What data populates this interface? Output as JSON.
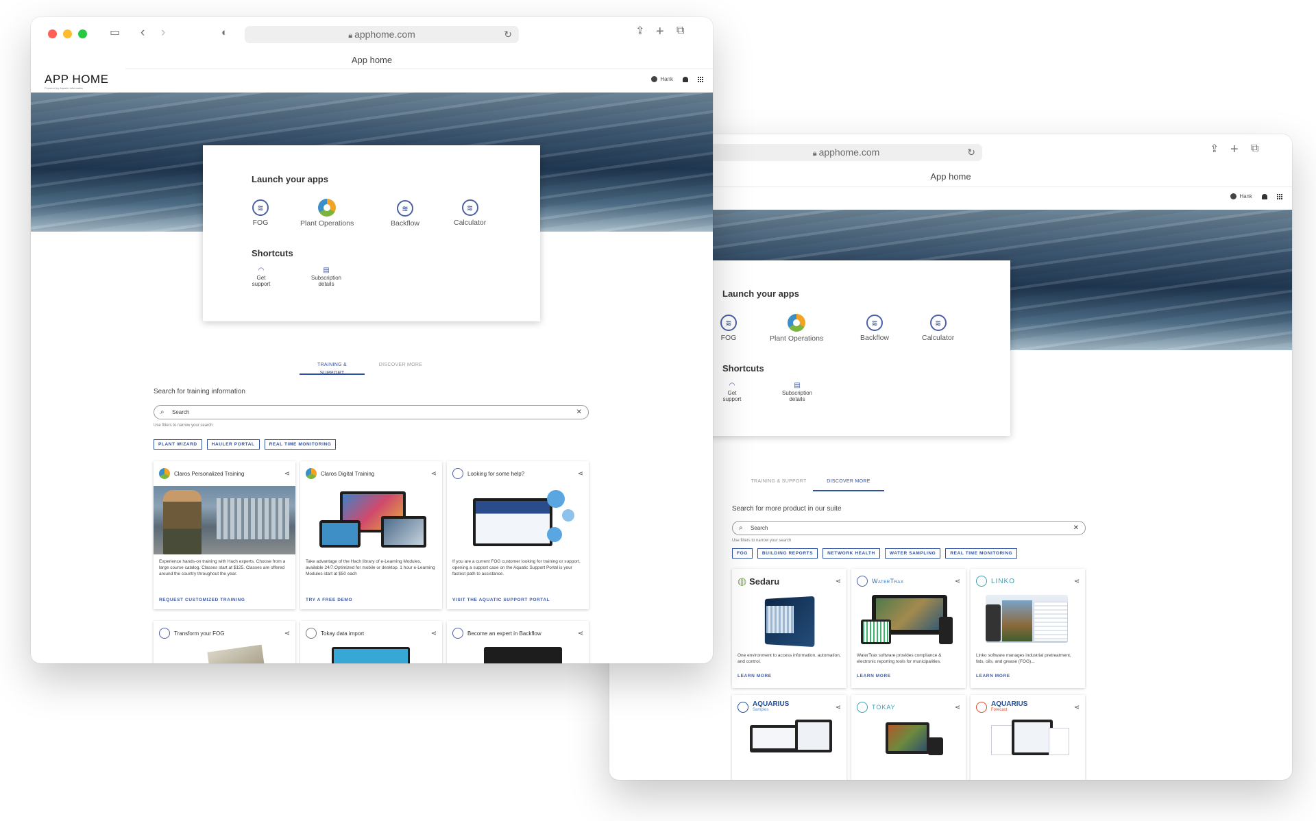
{
  "browser": {
    "url": "apphome.com",
    "title": "App home"
  },
  "header": {
    "brand": "APP HOME",
    "brand_sub": "Powered by Aquatic Informatics",
    "user": "Hank"
  },
  "launch": {
    "title": "Launch your apps",
    "apps": [
      {
        "label": "FOG",
        "icon": "waves-icon"
      },
      {
        "label": "Plant Operations",
        "icon": "claros-icon"
      },
      {
        "label": "Backflow",
        "icon": "waves-icon"
      },
      {
        "label": "Calculator",
        "icon": "waves-icon"
      }
    ],
    "shortcuts_title": "Shortcuts",
    "shortcuts": [
      {
        "line1": "Get",
        "line2": "support",
        "icon": "headset-icon"
      },
      {
        "line1": "Subscription",
        "line2": "details",
        "icon": "document-icon"
      }
    ]
  },
  "tabs": [
    "TRAINING & SUPPORT",
    "DISCOVER MORE"
  ],
  "training": {
    "search_label": "Search for training information",
    "search_placeholder": "Search",
    "hint": "Use filters to narrow your search",
    "chips": [
      "PLANT WIZARD",
      "HAULER PORTAL",
      "REAL TIME MONITORING"
    ],
    "cards": [
      {
        "title": "Claros Personalized Training",
        "desc": "Experience hands-on training with Hach experts. Choose from a large course catalog. Classes start at $125. Classes are offered around the country throughout the year.",
        "cta": "REQUEST CUSTOMIZED TRAINING"
      },
      {
        "title": "Claros Digital Training",
        "desc": "Take advantage of the Hach library of e-Learning Modules, available 24/7.Optimized for mobile or desktop. 1 hour e-Learning Modules start at $50 each",
        "cta": "TRY A FREE DEMO"
      },
      {
        "title": "Looking for some help?",
        "desc": "If you are a current FOG customer looking for training or support, opening a support case on the Aquatic Support Portal is your fastest path to assistance.",
        "cta": "VISIT THE AQUATIC SUPPORT PORTAL"
      },
      {
        "title": "Transform your FOG"
      },
      {
        "title": "Tokay data import"
      },
      {
        "title": "Become an expert in Backflow"
      }
    ]
  },
  "discover": {
    "search_label": "Search for more product in our suite",
    "search_placeholder": "Search",
    "hint": "Use filters to narrow your search",
    "chips": [
      "FOG",
      "BUILDING REPORTS",
      "NETWORK HEALTH",
      "WATER SAMPLING",
      "REAL TIME MONITORING"
    ],
    "cards": [
      {
        "brand": "Sedaru",
        "desc": "One environment to access information, automation, and control.",
        "cta": "LEARN MORE"
      },
      {
        "brand": "WaterTrax",
        "desc": "WaterTrax software provides compliance & electronic reporting tools for municipalities.",
        "cta": "LEARN MORE"
      },
      {
        "brand": "LINKO",
        "desc": "Linko software manages industrial pretreatment, fats, oils, and grease (FOG)...",
        "cta": "LEARN MORE"
      },
      {
        "brand": "AQUARIUS",
        "sub": "Samples"
      },
      {
        "brand": "TOKAY"
      },
      {
        "brand": "AQUARIUS",
        "sub": "Forecast"
      }
    ]
  }
}
